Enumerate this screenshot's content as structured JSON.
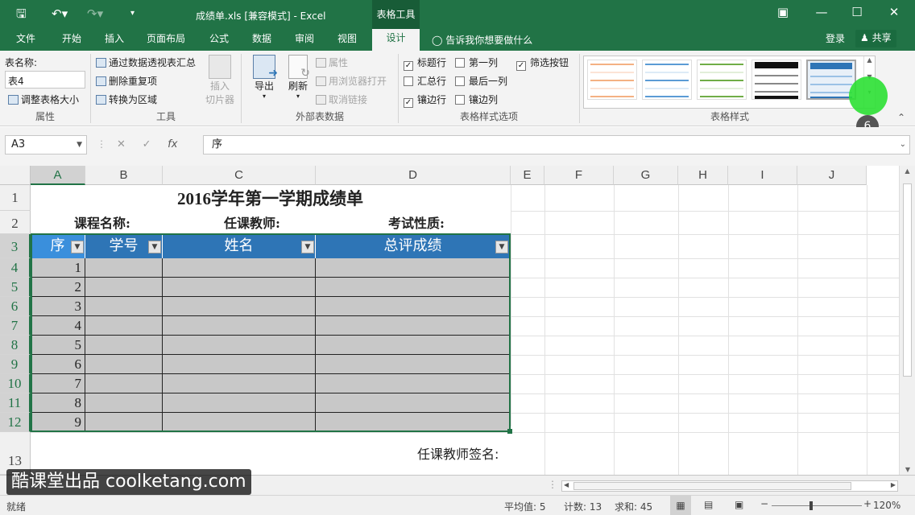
{
  "titlebar": {
    "title": "成绩单.xls  [兼容模式] - Excel",
    "context_tab": "表格工具"
  },
  "tabs": [
    "文件",
    "开始",
    "插入",
    "页面布局",
    "公式",
    "数据",
    "审阅",
    "视图",
    "设计"
  ],
  "active_tab": "设计",
  "tell_me": "告诉我你想要做什么",
  "login": "登录",
  "share": "共享",
  "ribbon": {
    "props": {
      "name_label": "表名称:",
      "name_value": "表4",
      "resize": "调整表格大小",
      "group": "属性"
    },
    "tools": {
      "pivot": "通过数据透视表汇总",
      "dedupe": "删除重复项",
      "convert": "转换为区域",
      "slicer1": "插入",
      "slicer2": "切片器",
      "group": "工具"
    },
    "external": {
      "export": "导出",
      "refresh": "刷新",
      "properties": "属性",
      "browser": "用浏览器打开",
      "unlink": "取消链接",
      "group": "外部表数据"
    },
    "options": {
      "header_row": "标题行",
      "first_col": "第一列",
      "filter_btn": "筛选按钮",
      "total_row": "汇总行",
      "last_col": "最后一列",
      "banded_rows": "镶边行",
      "banded_cols": "镶边列",
      "group": "表格样式选项"
    },
    "styles": {
      "group": "表格样式"
    }
  },
  "badge": "6",
  "formula": {
    "name_box": "A3",
    "value": "序"
  },
  "columns": [
    "A",
    "B",
    "C",
    "D",
    "E",
    "F",
    "G",
    "H",
    "I",
    "J"
  ],
  "rows": [
    "1",
    "2",
    "3",
    "4",
    "5",
    "6",
    "7",
    "8",
    "9",
    "10",
    "11",
    "12",
    "13"
  ],
  "sheet": {
    "title": "2016学年第一学期成绩单",
    "course": "课程名称:",
    "teacher": "任课教师:",
    "exam": "考试性质:",
    "headers": [
      "序",
      "学号",
      "姓名",
      "总评成绩"
    ],
    "seq": [
      "1",
      "2",
      "3",
      "4",
      "5",
      "6",
      "7",
      "8",
      "9"
    ],
    "sign": "任课教师签名:"
  },
  "status": {
    "ready": "就绪",
    "average": "平均值: 5",
    "count": "计数: 13",
    "sum": "求和: 45",
    "zoom": "120%"
  },
  "watermark": "酷课堂出品 coolketang.com"
}
